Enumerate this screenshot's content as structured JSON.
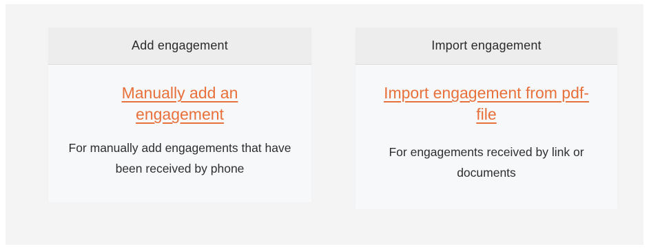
{
  "cards": [
    {
      "header": "Add engagement",
      "link_text": "Manually add an engagement",
      "description": "For manually add engagements that have been received by phone"
    },
    {
      "header": "Import engagement",
      "link_text": "Import engagement from pdf-file",
      "description": "For engagements received by link or documents"
    }
  ],
  "colors": {
    "link": "#e8703a",
    "panel_bg": "#f4f4f4",
    "header_bg": "#ededee"
  }
}
